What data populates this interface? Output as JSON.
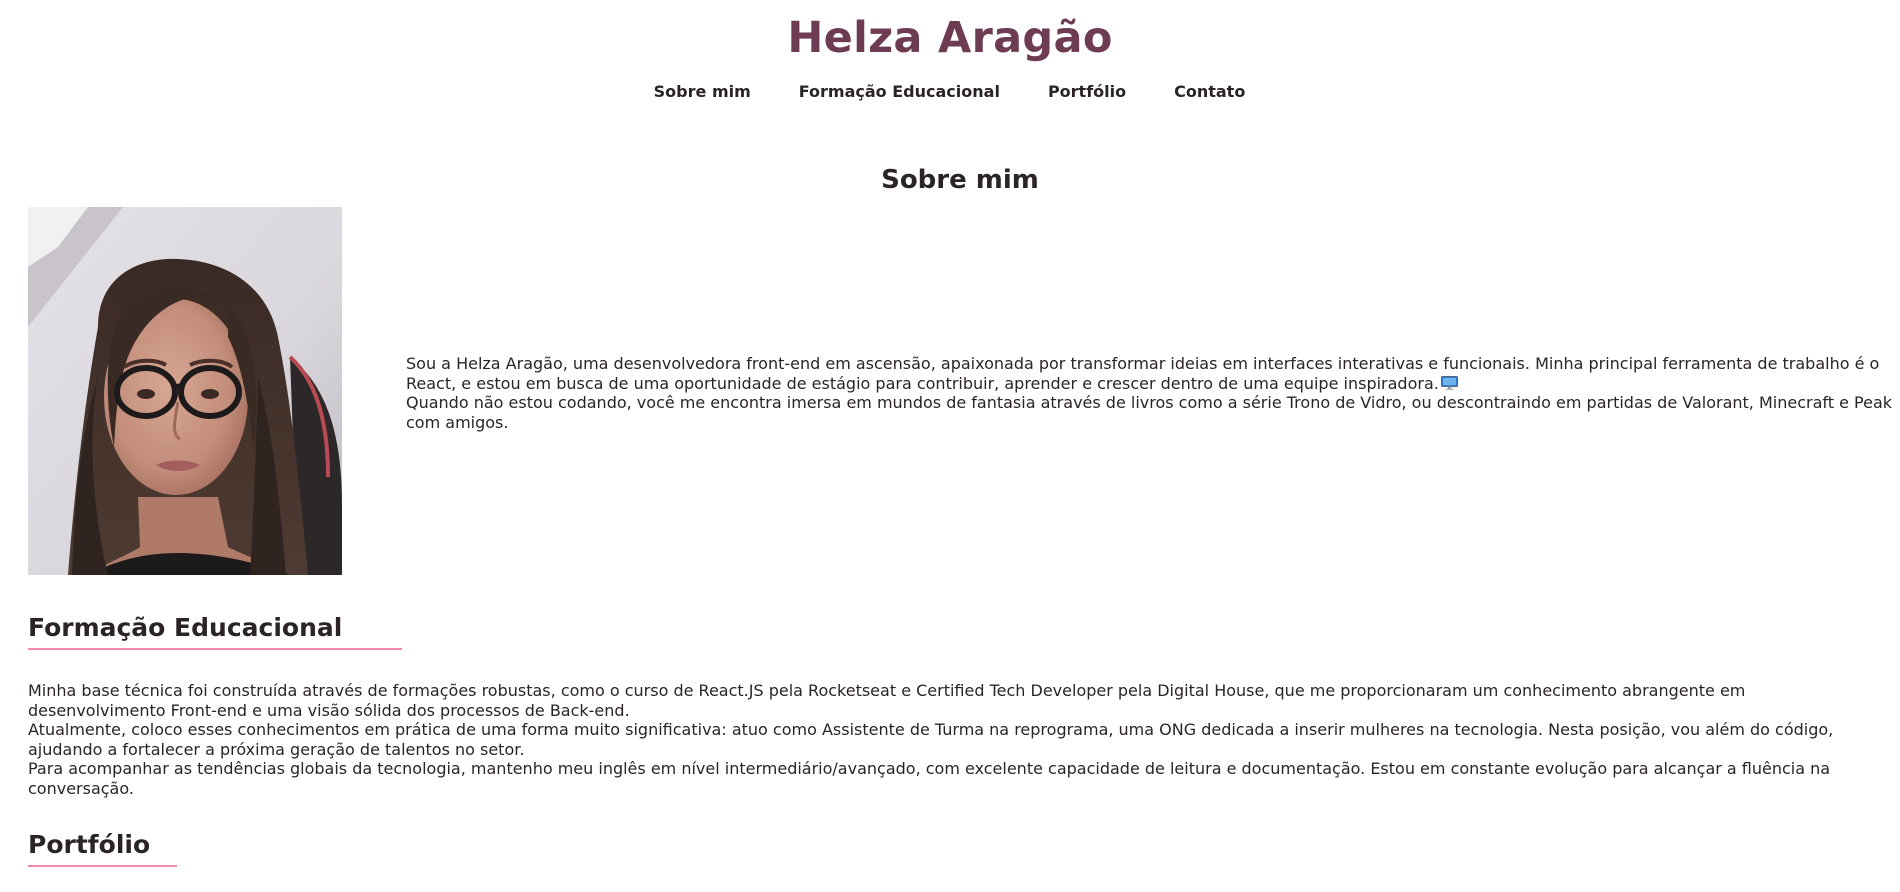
{
  "header": {
    "title": "Helza Aragão",
    "nav": [
      {
        "label": "Sobre mim"
      },
      {
        "label": "Formação Educacional"
      },
      {
        "label": "Portfólio"
      },
      {
        "label": "Contato"
      }
    ]
  },
  "about": {
    "title": "Sobre mim",
    "photo_alt": "Foto de Helza Aragão",
    "paragraphs": [
      "Sou a Helza Aragão, uma desenvolvedora front-end em ascensão, apaixonada por transformar ideias em interfaces interativas e funcionais. Minha principal ferramenta de trabalho é o React, e estou em busca de uma oportunidade de estágio para contribuir, aprender e crescer dentro de uma equipe inspiradora.",
      "Quando não estou codando, você me encontra imersa em mundos de fantasia através de livros como a série Trono de Vidro, ou descontraindo em partidas de Valorant, Minecraft e Peak com amigos."
    ],
    "emoji_icon": "desktop-computer-icon"
  },
  "education": {
    "title": "Formação Educacional",
    "paragraphs": [
      "Minha base técnica foi construída através de formações robustas, como o curso de React.JS pela Rocketseat e Certified Tech Developer pela Digital House, que me proporcionaram um conhecimento abrangente em desenvolvimento Front-end e uma visão sólida dos processos de Back-end.",
      "Atualmente, coloco esses conhecimentos em prática de uma forma muito significativa: atuo como Assistente de Turma na reprograma, uma ONG dedicada a inserir mulheres na tecnologia. Nesta posição, vou além do código, ajudando a fortalecer a próxima geração de talentos no setor.",
      "Para acompanhar as tendências globais da tecnologia, mantenho meu inglês em nível intermediário/avançado, com excelente capacidade de leitura e documentação. Estou em constante evolução para alcançar a fluência na conversação."
    ]
  },
  "portfolio": {
    "title": "Portfólio"
  },
  "colors": {
    "title": "#6e3c52",
    "text": "#2b2427",
    "accent_underline": "#f08aa6",
    "background": "#ffffff"
  }
}
